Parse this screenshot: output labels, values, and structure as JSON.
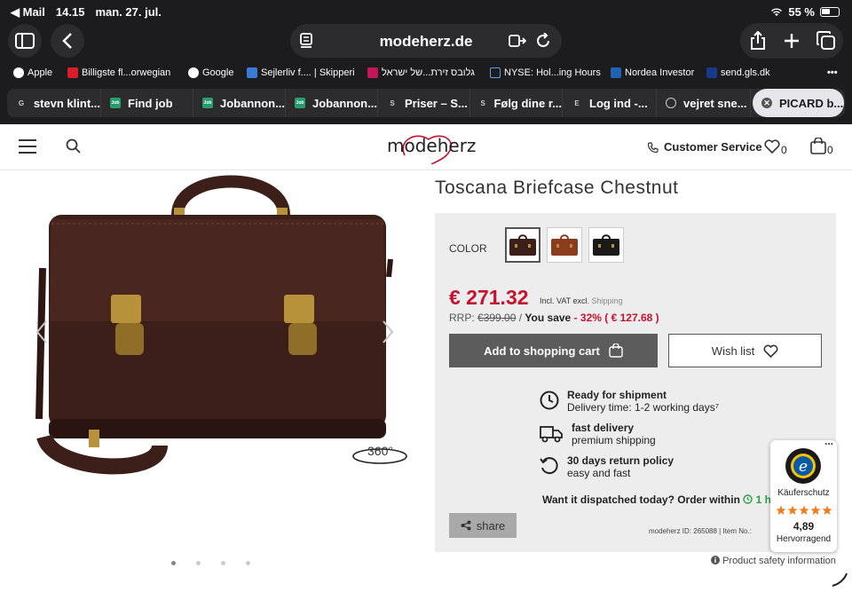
{
  "status_bar": {
    "back_app": "◀ Mail",
    "time": "14.15",
    "date": "man. 27. jul.",
    "battery": "55 %"
  },
  "browser": {
    "url": "modeherz.de",
    "bookmarks": [
      "Apple",
      "Billigste fl...orwegian",
      "Google",
      "Sejlerliv f.... | Skipperi",
      "גלובס זירת...של ישראל",
      "NYSE: Hol...ing Hours",
      "Nordea Investor",
      "send.gls.dk"
    ],
    "tabs": [
      {
        "icon": "G",
        "label": "stevn klint..."
      },
      {
        "icon": "Job",
        "label": "Find job"
      },
      {
        "icon": "Job",
        "label": "Jobannon..."
      },
      {
        "icon": "Job",
        "label": "Jobannon..."
      },
      {
        "icon": "S",
        "label": "Priser – S..."
      },
      {
        "icon": "S",
        "label": "Følg dine r..."
      },
      {
        "icon": "E",
        "label": "Log ind -..."
      },
      {
        "icon": "",
        "label": "vejret sne..."
      },
      {
        "icon": "",
        "label": "PICARD b..."
      }
    ]
  },
  "site": {
    "logo": "modeherz",
    "customer_service": "Customer Service",
    "wishlist_count": "0",
    "cart_count": "0"
  },
  "gallery": {
    "rotate_label": "360°",
    "dot_count": 4,
    "active_dot": 0
  },
  "product": {
    "title": "Toscana Briefcase Chestnut",
    "color_label": "COLOR",
    "price": "€ 271.32",
    "vat_note": "Incl. VAT excl.",
    "shipping_link": "Shipping",
    "rrp_label": "RRP:",
    "rrp_value": "€399.00",
    "rrp_sep": " / ",
    "you_save": "You save",
    "save_value": "- 32% ( € 127.68 )",
    "add_to_cart": "Add to shopping cart",
    "wish_list": "Wish list",
    "features": [
      {
        "title": "Ready for shipment",
        "sub": "Delivery time: 1-2 working days⁷"
      },
      {
        "title": "fast delivery",
        "sub": "premium shipping"
      },
      {
        "title": "30 days return policy",
        "sub": "easy and fast"
      }
    ],
    "dispatch_text": "Want it dispatched today? Order within",
    "dispatch_time": "1 hr",
    "share": "share",
    "ids": "modeherz ID: 265088 | Item No.:",
    "safety": "Product safety information"
  },
  "trust_badge": {
    "label": "Käuferschutz",
    "rating": "4,89",
    "rating_text": "Hervorragend",
    "menu": "..."
  },
  "colors": {
    "price_red": "#c8102e",
    "chrome_bg": "#1c1c1e",
    "leather_dark": "#3d1f1a",
    "leather_brown": "#8a3c1d",
    "black_bag": "#1a1a1a",
    "trusted_blue": "#0b5aa6",
    "star_orange": "#f07c1a"
  }
}
